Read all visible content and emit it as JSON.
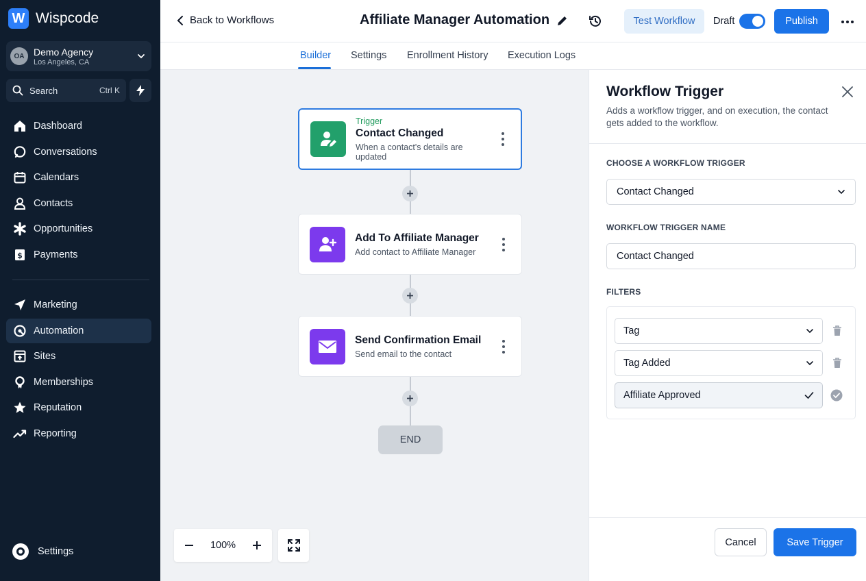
{
  "app": {
    "name": "Wispcode",
    "logo_letter": "W"
  },
  "account": {
    "initials": "OA",
    "name": "Demo Agency",
    "location": "Los Angeles, CA"
  },
  "search": {
    "label": "Search",
    "shortcut": "Ctrl K"
  },
  "nav_primary": [
    {
      "label": "Dashboard",
      "icon": "home-icon"
    },
    {
      "label": "Conversations",
      "icon": "chat-icon"
    },
    {
      "label": "Calendars",
      "icon": "calendar-icon"
    },
    {
      "label": "Contacts",
      "icon": "user-icon"
    },
    {
      "label": "Opportunities",
      "icon": "asterisk-icon"
    },
    {
      "label": "Payments",
      "icon": "payments-icon"
    }
  ],
  "nav_secondary": [
    {
      "label": "Marketing",
      "icon": "send-icon"
    },
    {
      "label": "Automation",
      "icon": "automation-icon",
      "active": true
    },
    {
      "label": "Sites",
      "icon": "sites-icon"
    },
    {
      "label": "Memberships",
      "icon": "badge-icon"
    },
    {
      "label": "Reputation",
      "icon": "star-icon"
    },
    {
      "label": "Reporting",
      "icon": "trend-icon"
    }
  ],
  "nav_settings": {
    "label": "Settings",
    "icon": "gear-icon"
  },
  "header": {
    "back_label": "Back to Workflows",
    "title": "Affiliate Manager Automation",
    "test_label": "Test Workflow",
    "draft_label": "Draft",
    "publish_label": "Publish"
  },
  "tabs": [
    {
      "label": "Builder",
      "active": true
    },
    {
      "label": "Settings"
    },
    {
      "label": "Enrollment History"
    },
    {
      "label": "Execution Logs"
    }
  ],
  "nodes": [
    {
      "eyebrow": "Trigger",
      "title": "Contact Changed",
      "subtitle": "When a contact's details are updated",
      "color": "#22a06b",
      "icon": "user-edit-icon"
    },
    {
      "title": "Add To Affiliate Manager",
      "subtitle": "Add contact to Affiliate Manager",
      "color": "#7c3aed",
      "icon": "user-plus-icon"
    },
    {
      "title": "Send Confirmation Email",
      "subtitle": "Send email to the contact",
      "color": "#7c3aed",
      "icon": "mail-icon"
    }
  ],
  "end_label": "END",
  "zoom": {
    "value": "100%"
  },
  "panel": {
    "title": "Workflow Trigger",
    "description": "Adds a workflow trigger, and on execution, the contact gets added to the workflow.",
    "choose_label": "CHOOSE A WORKFLOW TRIGGER",
    "choose_value": "Contact Changed",
    "name_label": "WORKFLOW TRIGGER NAME",
    "name_value": "Contact Changed",
    "filters_label": "FILTERS",
    "filters": [
      {
        "value": "Tag"
      },
      {
        "value": "Tag Added"
      },
      {
        "value": "Affiliate Approved"
      }
    ],
    "cancel_label": "Cancel",
    "save_label": "Save Trigger"
  },
  "colors": {
    "primary": "#1b73e8",
    "sidebar": "#0f1d2e",
    "trigger_green": "#22a06b",
    "action_purple": "#7c3aed"
  }
}
